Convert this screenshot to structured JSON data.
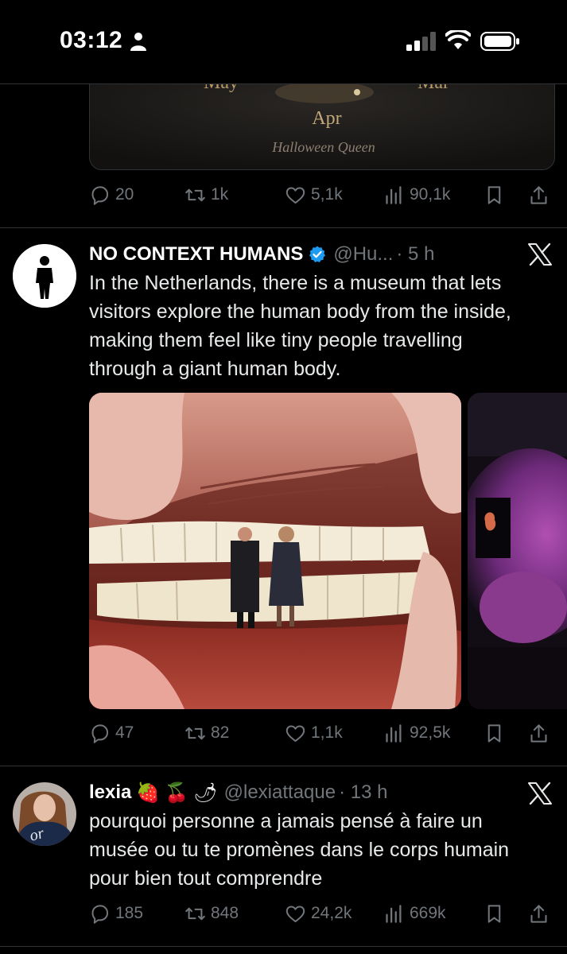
{
  "status_bar": {
    "time": "03:12"
  },
  "prev_tweet": {
    "media_texts": {
      "left_month": "May",
      "center_month": "Apr",
      "right_month": "Mar",
      "caption": "Halloween Queen"
    },
    "actions": {
      "replies": "20",
      "reposts": "1k",
      "likes": "5,1k",
      "views": "90,1k"
    }
  },
  "tweet1": {
    "name": "NO CONTEXT HUMANS",
    "handle": "@Hu...",
    "time": "· 5 h",
    "text_lines": [
      "In the Netherlands, there is a museum that lets",
      "visitors explore the human body from the inside,",
      "making them feel like tiny people travelling",
      "through a giant human body."
    ],
    "actions": {
      "replies": "47",
      "reposts": "82",
      "likes": "1,1k",
      "views": "92,5k"
    }
  },
  "tweet2": {
    "name": "lexia",
    "emojis": [
      "🍓",
      "🍒",
      "🌶"
    ],
    "handle": "@lexiattaque",
    "time": "· 13 h",
    "avatar_text": "or",
    "text_lines": [
      "pourquoi personne a jamais pensé à faire un",
      "musée ou tu te promènes dans le corps humain",
      "pour bien tout comprendre"
    ],
    "actions": {
      "replies": "185",
      "reposts": "848",
      "likes": "24,2k",
      "views": "669k"
    }
  },
  "colors": {
    "background": "#000000",
    "muted": "#71767b",
    "verified": "#1d9bf0",
    "divider": "#2f3336"
  }
}
